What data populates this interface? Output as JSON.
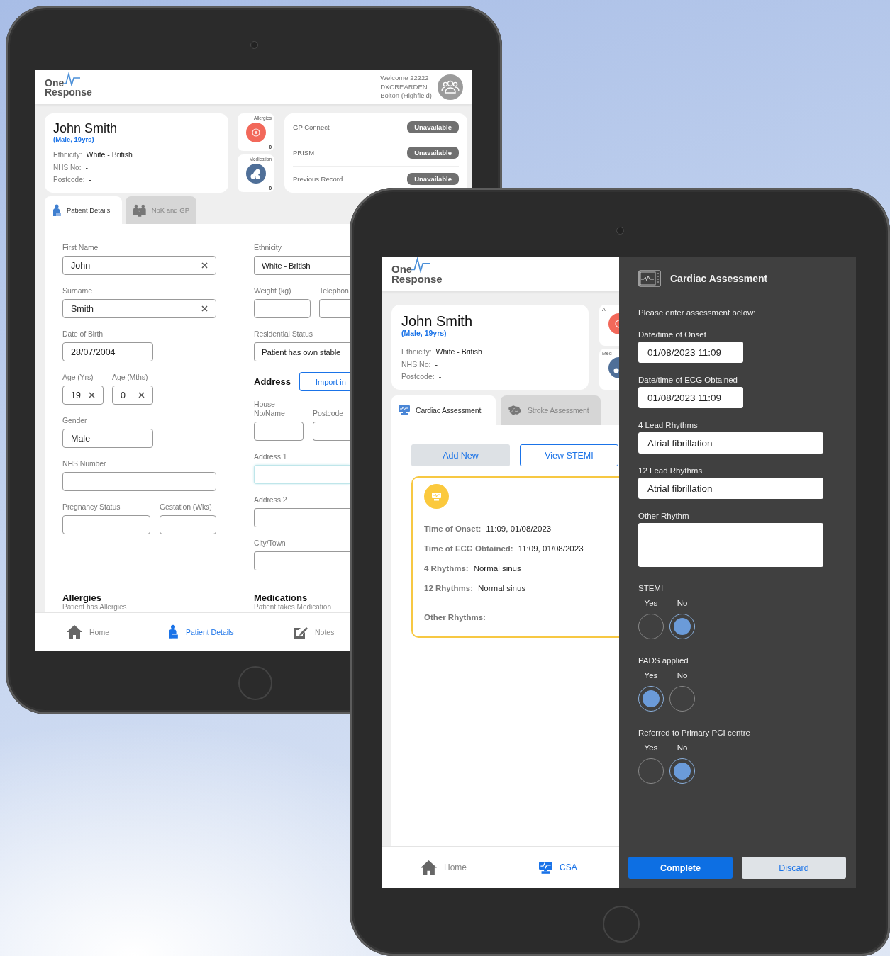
{
  "patient_tablet": {
    "header": {
      "logo_top": "One",
      "logo_bottom": "Response",
      "welcome_lines": [
        "Welcome 22222",
        "DXCREARDEN",
        "Bolton (Highfield)"
      ]
    },
    "patient": {
      "name": "John Smith",
      "summary": "(Male, 19yrs)",
      "details": [
        {
          "label": "Ethnicity:",
          "value": "White - British"
        },
        {
          "label": "NHS No:",
          "value": "-"
        },
        {
          "label": "Postcode:",
          "value": "-"
        }
      ]
    },
    "tiles": [
      {
        "label": "Allergies",
        "count": "0",
        "kind": "allergies"
      },
      {
        "label": "Medication",
        "count": "0",
        "kind": "medication"
      }
    ],
    "records": [
      {
        "name": "GP Connect",
        "status": "Unavailable"
      },
      {
        "name": "PRISM",
        "status": "Unavailable"
      },
      {
        "name": "Previous Record",
        "status": "Unavailable"
      }
    ],
    "tabs": [
      {
        "label": "Patient Details",
        "kind": "patient",
        "selected": true
      },
      {
        "label": "NoK and GP",
        "kind": "family",
        "selected": false
      }
    ],
    "left_column": [
      {
        "fields": [
          {
            "label": "First Name",
            "value": "John",
            "clearable": true,
            "focused": false
          }
        ]
      },
      {
        "fields": [
          {
            "label": "Surname",
            "value": "Smith",
            "clearable": true,
            "focused": false
          }
        ]
      },
      {
        "fields": [
          {
            "label": "Date of Birth",
            "value": "28/07/2004",
            "clearable": false,
            "focused": false
          }
        ]
      },
      {
        "fields": [
          {
            "label": "Age (Yrs)",
            "value": "19",
            "clearable": true,
            "focused": false
          },
          {
            "label": "Age (Mths)",
            "value": "0",
            "clearable": true,
            "focused": false
          }
        ]
      },
      {
        "fields": [
          {
            "label": "Gender",
            "value": "Male",
            "clearable": false,
            "focused": false
          }
        ]
      },
      {
        "fields": [
          {
            "label": "NHS Number",
            "clearable": false,
            "focused": false
          }
        ]
      },
      {
        "fields": [
          {
            "label": "Pregnancy Status",
            "clearable": false,
            "focused": false
          },
          {
            "label": "Gestation (Wks)",
            "clearable": false,
            "focused": false
          }
        ]
      }
    ],
    "right_column": [
      {
        "kind": "fields",
        "fields": [
          {
            "label": "Ethnicity",
            "value": "White - British",
            "clearable": false,
            "focused": false
          }
        ]
      },
      {
        "kind": "fields",
        "fields": [
          {
            "label": "Weight (kg)",
            "clearable": false,
            "focused": false
          },
          {
            "label": "Telephon",
            "clearable": false,
            "focused": false
          }
        ]
      },
      {
        "kind": "fields",
        "fields": [
          {
            "label": "Residential Status",
            "value": "Patient has own stable",
            "clearable": false,
            "focused": false
          }
        ]
      },
      {
        "kind": "heading",
        "title": "Address",
        "button": "Import in"
      },
      {
        "kind": "fields",
        "fields": [
          {
            "label": "House No/Name",
            "clearable": false,
            "focused": false
          },
          {
            "label": "Postcode",
            "clearable": false,
            "focused": false
          }
        ]
      },
      {
        "kind": "fields",
        "fields": [
          {
            "label": "Address 1",
            "clearable": false,
            "focused": true
          }
        ]
      },
      {
        "kind": "fields",
        "fields": [
          {
            "label": "Address 2",
            "clearable": false,
            "focused": false
          }
        ]
      },
      {
        "kind": "fields",
        "fields": [
          {
            "label": "City/Town",
            "clearable": false,
            "focused": false
          }
        ]
      }
    ],
    "sections": [
      {
        "title": "Allergies",
        "subtitle": "Patient has Allergies"
      },
      {
        "title": "Medications",
        "subtitle": "Patient takes Medication"
      }
    ],
    "nav": [
      {
        "label": "Home",
        "kind": "home",
        "selected": false
      },
      {
        "label": "Patient Details",
        "kind": "patient",
        "selected": true
      },
      {
        "label": "Notes",
        "kind": "notes",
        "selected": false
      }
    ]
  },
  "cardiac_tablet": {
    "header": {
      "logo_top": "One",
      "logo_bottom": "Response"
    },
    "patient": {
      "name": "John Smith",
      "summary": "(Male, 19yrs)",
      "details": [
        {
          "label": "Ethnicity:",
          "value": "White - British"
        },
        {
          "label": "NHS No:",
          "value": "-"
        },
        {
          "label": "Postcode:",
          "value": "-"
        }
      ]
    },
    "tiles": [
      {
        "label": "Al",
        "kind": "allergies"
      },
      {
        "label": "Med",
        "kind": "medication"
      }
    ],
    "tabs": [
      {
        "label": "Cardiac Assessment",
        "kind": "monitor",
        "selected": true
      },
      {
        "label": "Stroke Assessment",
        "kind": "brain",
        "selected": false
      }
    ],
    "actions": [
      {
        "label": "Add New",
        "kind": "filled"
      },
      {
        "label": "View STEMI",
        "kind": "outline"
      }
    ],
    "record": [
      {
        "label": "Time of Onset:",
        "value": "11:09, 01/08/2023"
      },
      {
        "label": "Time of ECG Obtained:",
        "value": "11:09, 01/08/2023"
      },
      {
        "label": "4 Rhythms:",
        "value": "Normal sinus"
      },
      {
        "label": "12 Rhythms:",
        "value": "Normal sinus"
      },
      {
        "label": "Other Rhythms:"
      }
    ],
    "nav": [
      {
        "label": "Home",
        "kind": "home",
        "selected": false
      },
      {
        "label": "CSA",
        "kind": "monitor",
        "selected": true
      }
    ],
    "panel": {
      "title": "Cardiac Assessment",
      "intro": "Please enter assessment below:",
      "fields": [
        {
          "label": "Date/time of Onset",
          "value": "01/08/2023 11:09",
          "kind": "datetime"
        },
        {
          "label": "Date/time of ECG Obtained",
          "value": "01/08/2023 11:09",
          "kind": "datetime"
        },
        {
          "label": "4 Lead Rhythms",
          "value": "Atrial fibrillation",
          "kind": "text"
        },
        {
          "label": "12 Lead Rhythms",
          "value": "Atrial fibrillation",
          "kind": "text"
        },
        {
          "label": "Other Rhythm",
          "kind": "textarea"
        }
      ],
      "radio_groups": [
        {
          "label": "STEMI",
          "options": [
            {
              "label": "Yes",
              "selected": false
            },
            {
              "label": "No",
              "selected": true
            }
          ]
        },
        {
          "label": "PADS applied",
          "options": [
            {
              "label": "Yes",
              "selected": true
            },
            {
              "label": "No",
              "selected": false
            }
          ]
        },
        {
          "label": "Referred to Primary PCI centre",
          "options": [
            {
              "label": "Yes",
              "selected": false
            },
            {
              "label": "No",
              "selected": true
            }
          ]
        }
      ],
      "buttons": [
        {
          "label": "Complete",
          "kind": "primary"
        },
        {
          "label": "Discard",
          "kind": "secondary"
        }
      ]
    }
  }
}
